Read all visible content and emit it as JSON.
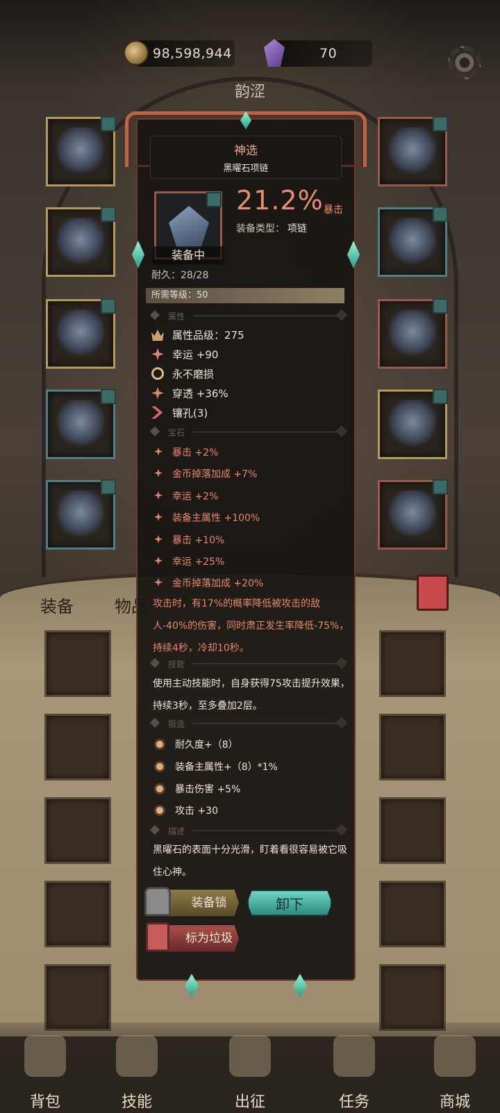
{
  "header": {
    "gold": "98,598,944",
    "gems": "70",
    "hero_name": "韵涩"
  },
  "item": {
    "rarity": "神选",
    "name": "黑曜石项链",
    "equipped_tag": "装备中",
    "crit_value": "21.2%",
    "crit_label": "暴击",
    "type_label": "装备类型：",
    "type_value": "项链",
    "durability": "耐久：28/28",
    "required_level": "所需等级：50"
  },
  "sections": {
    "attributes": "属性",
    "gems": "宝石",
    "skills": "技能",
    "forge": "锻造",
    "description": "描述"
  },
  "attributes": [
    {
      "icon": "crown-icon",
      "text": "属性品级：275"
    },
    {
      "icon": "star-icon",
      "text": "幸运 +90"
    },
    {
      "icon": "ring-icon",
      "text": "永不磨损"
    },
    {
      "icon": "star-icon",
      "text": "穿透 +36%"
    },
    {
      "icon": "chevron-icon",
      "text": "镶孔(3)"
    }
  ],
  "gem_bonuses": [
    "暴击 +2%",
    "金币掉落加成 +7%",
    "幸运 +2%",
    "装备主属性 +100%",
    "暴击 +10%",
    "幸运 +25%",
    "金币掉落加成 +20%"
  ],
  "gem_effect": "攻击时，有17%的概率降低被攻击的敌人-40%的伤害，同时肃正发生率降低-75%，持续4秒，冷却10秒。",
  "skill_text": "使用主动技能时，自身获得75攻击提升效果，持续3秒，至多叠加2层。",
  "forge_bonuses": [
    "耐久度+（8）",
    "装备主属性+（8）*1%",
    "暴击伤害 +5%",
    "攻击 +30"
  ],
  "description": "黑曜石的表面十分光滑，盯着看很容易被它吸住心神。",
  "buttons": {
    "lock": "装备锁",
    "unequip": "卸下",
    "junk": "标为垃圾"
  },
  "bag_tabs": [
    "装备",
    "物品"
  ],
  "nav": [
    "背包",
    "技能",
    "出征",
    "任务",
    "商城"
  ],
  "colors": {
    "rarity": "#e7a88a",
    "crit": "#e98e70",
    "gem_text": "#e9876a",
    "accent_teal": "#6ed6c6"
  }
}
